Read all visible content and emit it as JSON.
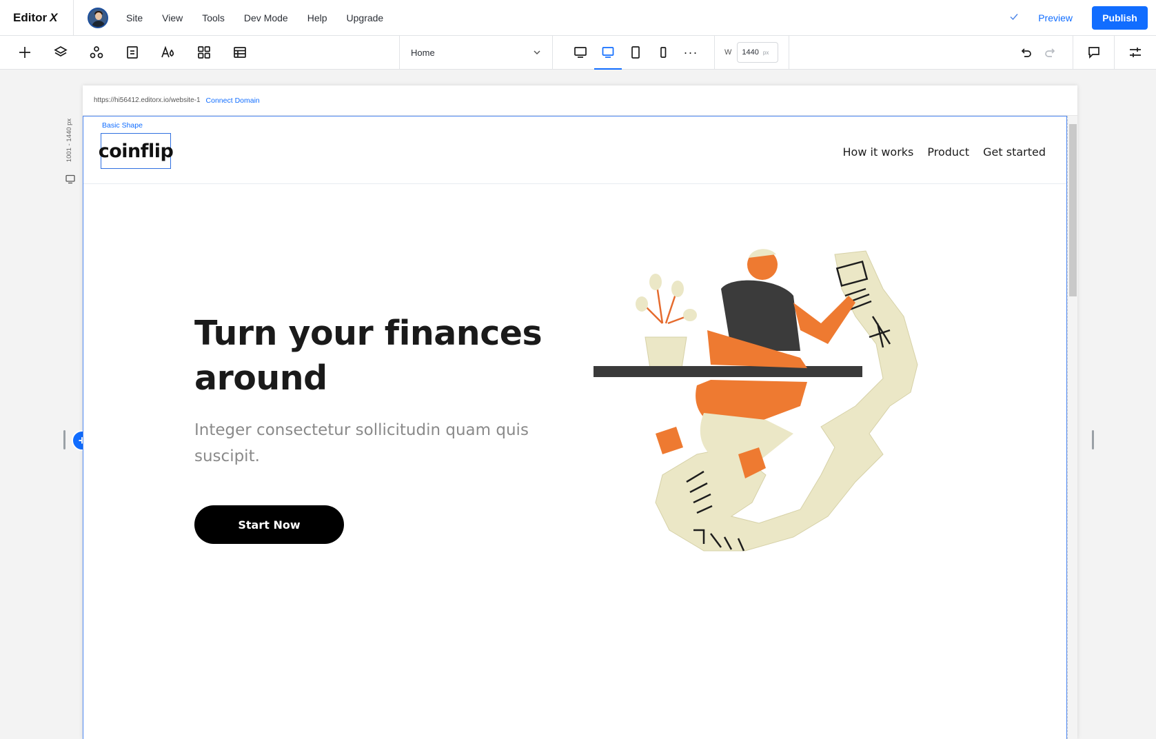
{
  "app": {
    "brand": "Editor",
    "brand_mark": "X",
    "menu": [
      "Site",
      "View",
      "Tools",
      "Dev Mode",
      "Help",
      "Upgrade"
    ],
    "saved_icon": "check-icon",
    "preview_label": "Preview",
    "publish_label": "Publish",
    "accent_color": "#116dff"
  },
  "toolbar": {
    "left_tools": [
      "add-icon",
      "layers-icon",
      "components-icon",
      "pages-icon",
      "theme-icon",
      "apps-icon",
      "cms-icon"
    ],
    "page_select": "Home",
    "devices": [
      "desktop-large-icon",
      "desktop-icon",
      "tablet-icon",
      "mobile-icon"
    ],
    "active_device": "desktop-icon",
    "more_label": "···",
    "width_label": "W",
    "width_value": "1440",
    "width_unit": "px"
  },
  "canvas": {
    "url": "https://hi56412.editorx.io/website-1",
    "connect_domain": "Connect Domain",
    "breakpoint_range": "1001 - 1440 px"
  },
  "site": {
    "selected_label": "Basic Shape",
    "logo": "coinflip",
    "nav": [
      "How it works",
      "Product",
      "Get started"
    ],
    "hero_title": "Turn your finances around",
    "hero_subtitle": "Integer consectetur sollicitudin quam quis suscipit.",
    "cta": "Start Now"
  }
}
